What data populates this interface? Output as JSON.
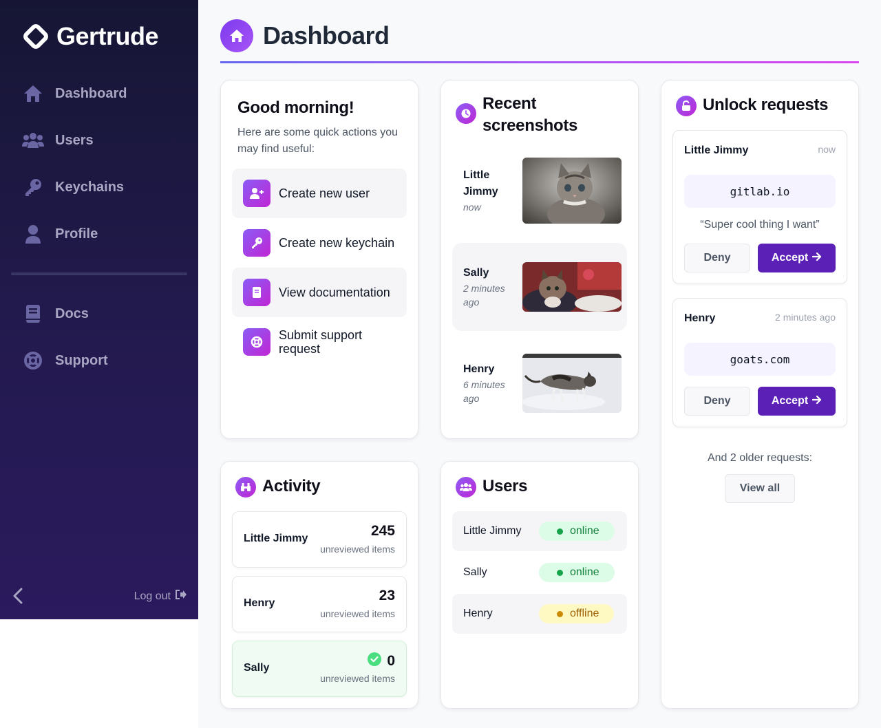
{
  "app": {
    "name": "Gertrude"
  },
  "sidebar": {
    "items": [
      {
        "label": "Dashboard",
        "icon": "home-icon"
      },
      {
        "label": "Users",
        "icon": "users-icon"
      },
      {
        "label": "Keychains",
        "icon": "key-icon"
      },
      {
        "label": "Profile",
        "icon": "user-icon"
      },
      {
        "label": "Docs",
        "icon": "book-icon"
      },
      {
        "label": "Support",
        "icon": "lifebuoy-icon"
      }
    ],
    "logout_label": "Log out"
  },
  "header": {
    "title": "Dashboard"
  },
  "quick_actions": {
    "title": "Good morning!",
    "subtitle": "Here are some quick actions you may find useful:",
    "items": [
      {
        "label": "Create new user",
        "icon": "user-plus-icon"
      },
      {
        "label": "Create new keychain",
        "icon": "key-icon"
      },
      {
        "label": "View documentation",
        "icon": "book-icon"
      },
      {
        "label": "Submit support request",
        "icon": "lifebuoy-icon"
      }
    ]
  },
  "screenshots": {
    "title": "Recent screenshots",
    "items": [
      {
        "name": "Little Jimmy",
        "time": "now"
      },
      {
        "name": "Sally",
        "time": "2 minutes ago"
      },
      {
        "name": "Henry",
        "time": "6 minutes ago"
      }
    ]
  },
  "unlock": {
    "title": "Unlock requests",
    "requests": [
      {
        "name": "Little Jimmy",
        "time": "now",
        "host": "gitlab.io",
        "note": "“Super cool thing I want”"
      },
      {
        "name": "Henry",
        "time": "2 minutes ago",
        "host": "goats.com"
      }
    ],
    "deny_label": "Deny",
    "accept_label": "Accept",
    "older_text": "And 2 older requests:",
    "view_all_label": "View all"
  },
  "activity": {
    "title": "Activity",
    "items": [
      {
        "name": "Little Jimmy",
        "count": "245",
        "sub": "unreviewed items"
      },
      {
        "name": "Henry",
        "count": "23",
        "sub": "unreviewed items"
      },
      {
        "name": "Sally",
        "count": "0",
        "sub": "unreviewed items"
      }
    ]
  },
  "users": {
    "title": "Users",
    "items": [
      {
        "name": "Little Jimmy",
        "status": "online"
      },
      {
        "name": "Sally",
        "status": "online"
      },
      {
        "name": "Henry",
        "status": "offline"
      }
    ]
  },
  "colors": {
    "accent": "#5b21b6",
    "gradient_start": "#8b5cf6",
    "gradient_end": "#c026d3",
    "sidebar": "#1e1a45"
  }
}
